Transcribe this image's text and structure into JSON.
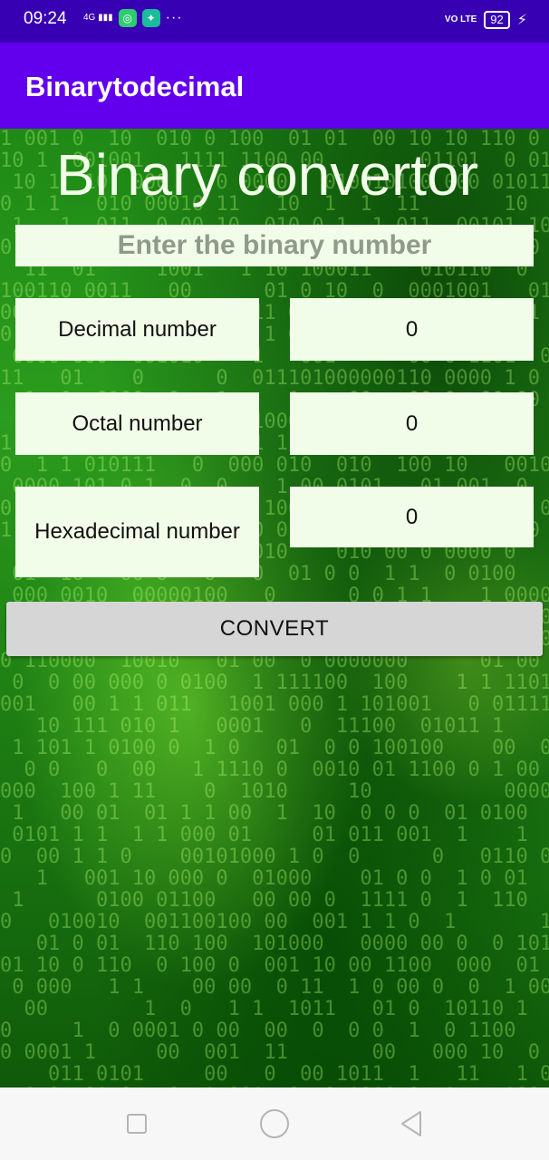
{
  "status_bar": {
    "time": "09:24",
    "network": "4G",
    "volte": "VO LTE",
    "battery": "92"
  },
  "app_bar": {
    "title": "Binarytodecimal"
  },
  "main": {
    "title": "Binary convertor",
    "binary_input": {
      "value": "",
      "placeholder": "Enter the binary number"
    },
    "rows": [
      {
        "label": "Decimal number",
        "value": "0"
      },
      {
        "label": "Octal number",
        "value": "0"
      },
      {
        "label": "Hexadecimal number",
        "value": "0"
      }
    ],
    "convert_label": "CONVERT"
  },
  "colors": {
    "status_bar": "#3700b3",
    "app_bar": "#6200ee",
    "field_bg": "#f1fde8",
    "button_bg": "#d6d6d6"
  }
}
